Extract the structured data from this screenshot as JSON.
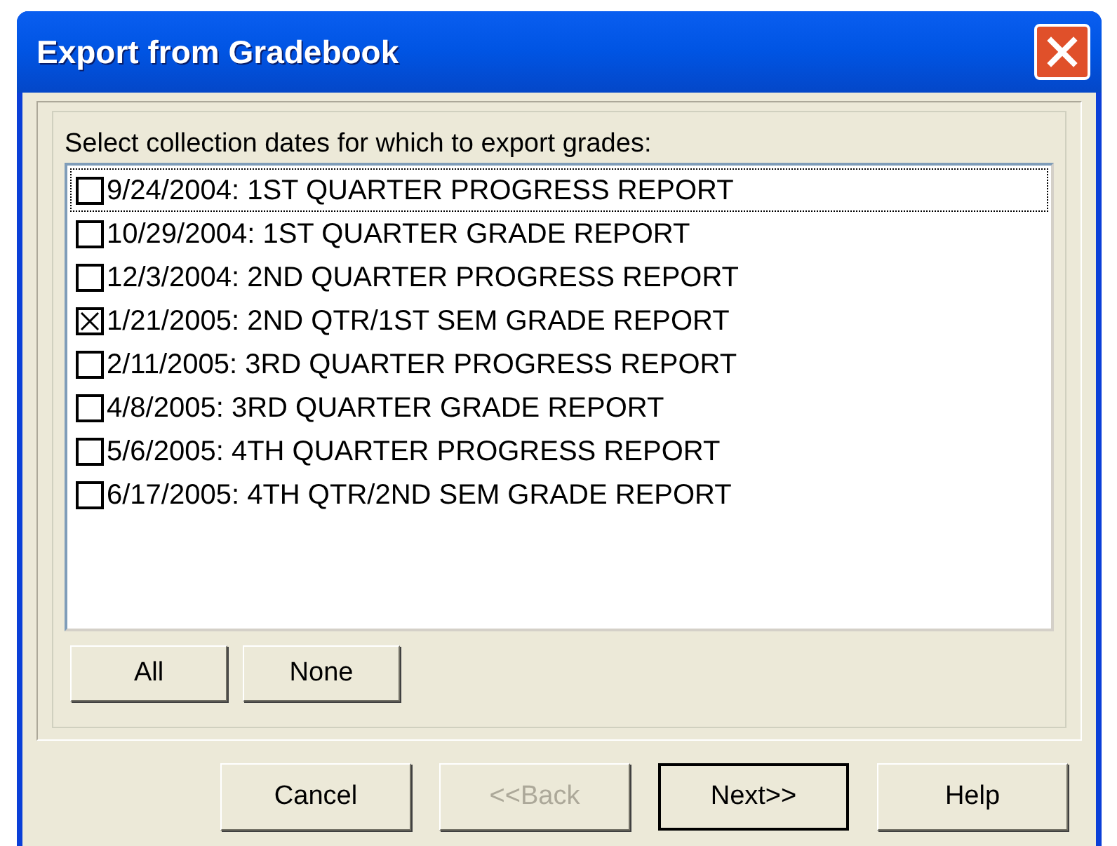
{
  "window": {
    "title": "Export from Gradebook"
  },
  "prompt": "Select collection dates for which to export grades:",
  "items": [
    {
      "label": "9/24/2004: 1ST QUARTER PROGRESS REPORT",
      "checked": false,
      "focused": true
    },
    {
      "label": "10/29/2004: 1ST QUARTER GRADE REPORT",
      "checked": false,
      "focused": false
    },
    {
      "label": "12/3/2004: 2ND QUARTER PROGRESS REPORT",
      "checked": false,
      "focused": false
    },
    {
      "label": "1/21/2005: 2ND QTR/1ST SEM GRADE REPORT",
      "checked": true,
      "focused": false
    },
    {
      "label": "2/11/2005: 3RD QUARTER PROGRESS REPORT",
      "checked": false,
      "focused": false
    },
    {
      "label": "4/8/2005: 3RD QUARTER GRADE REPORT",
      "checked": false,
      "focused": false
    },
    {
      "label": "5/6/2005: 4TH QUARTER PROGRESS REPORT",
      "checked": false,
      "focused": false
    },
    {
      "label": "6/17/2005: 4TH QTR/2ND SEM GRADE REPORT",
      "checked": false,
      "focused": false
    }
  ],
  "select_buttons": [
    "All",
    "None"
  ],
  "buttons": [
    {
      "label": "Cancel",
      "disabled": false,
      "default": false
    },
    {
      "label": "<<Back",
      "disabled": true,
      "default": false
    },
    {
      "label": "Next>>",
      "disabled": false,
      "default": true
    },
    {
      "label": "Help",
      "disabled": false,
      "default": false
    }
  ]
}
